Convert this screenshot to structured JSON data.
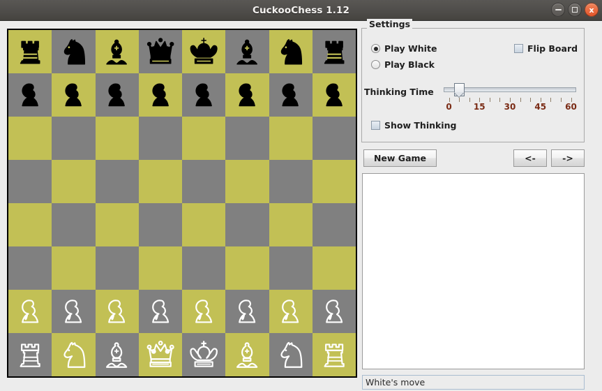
{
  "window": {
    "title": "CuckooChess 1.12",
    "controls": [
      {
        "name": "minimize-button",
        "glyph": "minimize"
      },
      {
        "name": "maximize-button",
        "glyph": "maximize"
      },
      {
        "name": "close-button",
        "glyph": "close",
        "label": "x"
      }
    ]
  },
  "board": {
    "light_color": "#c2c055",
    "dark_color": "#808080",
    "border_color": "#000000",
    "orientation": "white-bottom",
    "position": [
      [
        "r",
        "n",
        "b",
        "q",
        "k",
        "b",
        "n",
        "r"
      ],
      [
        "p",
        "p",
        "p",
        "p",
        "p",
        "p",
        "p",
        "p"
      ],
      [
        "",
        "",
        "",
        "",
        "",
        "",
        "",
        ""
      ],
      [
        "",
        "",
        "",
        "",
        "",
        "",
        "",
        ""
      ],
      [
        "",
        "",
        "",
        "",
        "",
        "",
        "",
        ""
      ],
      [
        "",
        "",
        "",
        "",
        "",
        "",
        "",
        ""
      ],
      [
        "P",
        "P",
        "P",
        "P",
        "P",
        "P",
        "P",
        "P"
      ],
      [
        "R",
        "N",
        "B",
        "Q",
        "K",
        "B",
        "N",
        "R"
      ]
    ]
  },
  "settings": {
    "title": "Settings",
    "play_white": {
      "label": "Play White",
      "checked": true
    },
    "play_black": {
      "label": "Play Black",
      "checked": false
    },
    "flip_board": {
      "label": "Flip Board",
      "checked": false
    },
    "show_thinking": {
      "label": "Show Thinking",
      "checked": false
    },
    "thinking_time": {
      "label": "Thinking Time",
      "value": 5,
      "min": 0,
      "max": 60,
      "tick_spacing": 5,
      "labels": [
        "0",
        "15",
        "30",
        "45",
        "60"
      ],
      "label_values": [
        0,
        15,
        30,
        45,
        60
      ],
      "label_color": "#7a2b15"
    }
  },
  "toolbar": {
    "new_game_label": "New Game",
    "prev_label": "<-",
    "next_label": "->"
  },
  "move_list": {
    "text": ""
  },
  "status": {
    "text": "White's move"
  }
}
